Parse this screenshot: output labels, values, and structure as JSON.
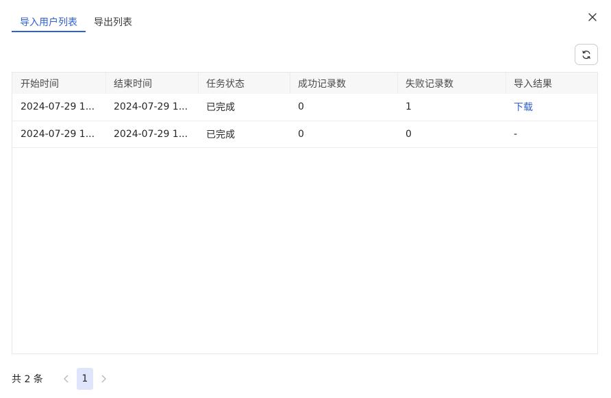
{
  "tabs": [
    {
      "label": "导入用户列表",
      "active": true
    },
    {
      "label": "导出列表",
      "active": false
    }
  ],
  "icons": {
    "close": "close-icon",
    "refresh": "refresh-icon",
    "prev": "chevron-left-icon",
    "next": "chevron-right-icon"
  },
  "colors": {
    "accent": "#2f5fd4",
    "page_active_bg": "#dfe6fb",
    "header_bg": "#f7f7f7"
  },
  "table": {
    "columns": [
      "开始时间",
      "结束时间",
      "任务状态",
      "成功记录数",
      "失败记录数",
      "导入结果"
    ],
    "rows": [
      [
        "2024-07-29 1...",
        "2024-07-29 1...",
        "已完成",
        "0",
        "1",
        "下载"
      ],
      [
        "2024-07-29 1...",
        "2024-07-29 1...",
        "已完成",
        "0",
        "0",
        "-"
      ]
    ]
  },
  "pagination": {
    "total": "共 2 条",
    "current_page": "1"
  }
}
